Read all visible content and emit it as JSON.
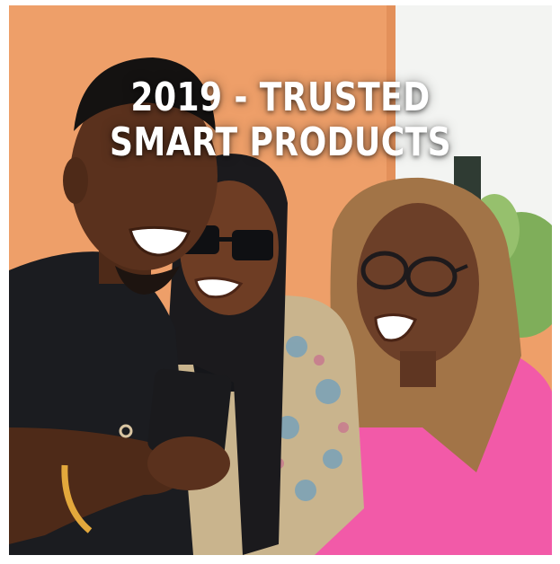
{
  "banner": {
    "headline_line1": "2019 - TRUSTED",
    "headline_line2": "SMART PRODUCTS"
  },
  "colors": {
    "background_wall": "#eea06a",
    "sky": "#f3f4f2",
    "foliage": "#7fae5a",
    "headline_text": "#ffffff",
    "pink_shirt": "#f25aa8",
    "black_shirt": "#1b1c20"
  },
  "photo": {
    "subjects": [
      "man-black-tshirt",
      "woman-sunglasses-braids",
      "woman-glasses-pink-top"
    ],
    "held_object": "smartphone"
  }
}
